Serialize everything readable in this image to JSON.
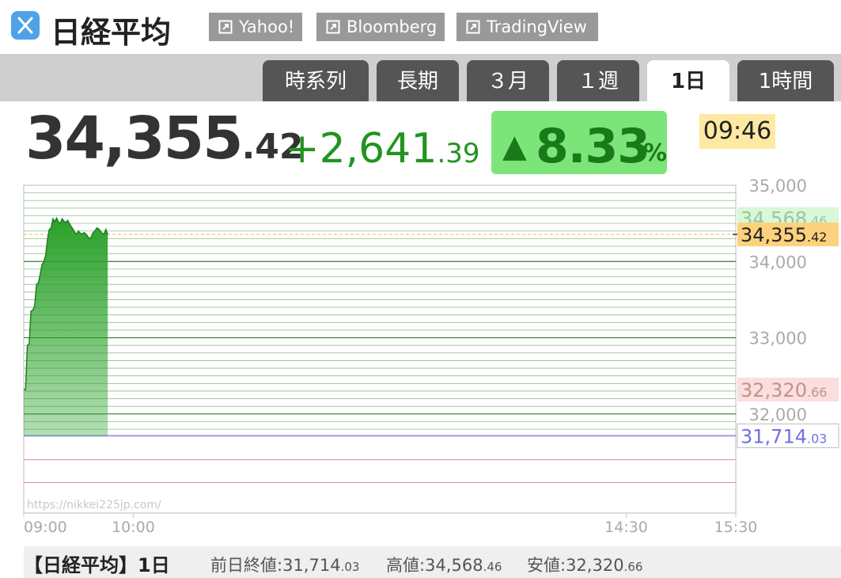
{
  "header": {
    "title": "日経平均",
    "links": [
      {
        "label": "Yahoo!"
      },
      {
        "label": "Bloomberg"
      },
      {
        "label": "TradingView"
      }
    ]
  },
  "tabs": [
    {
      "label": "時系列",
      "active": false
    },
    {
      "label": "長期",
      "active": false
    },
    {
      "label": "３月",
      "active": false
    },
    {
      "label": "１週",
      "active": false
    },
    {
      "label": "1日",
      "active": true
    },
    {
      "label": "1時間",
      "active": false
    }
  ],
  "quote": {
    "price_int": "34,355",
    "price_dec": ".42",
    "change_int": "+2,641",
    "change_dec": ".39",
    "pct_arrow": "▲",
    "pct_value": "8.33",
    "pct_unit": "%",
    "time": "09:46"
  },
  "colors": {
    "up": "#22941f",
    "pct_bg": "#7ce57a",
    "line_fill": "#2aa12a",
    "prev_close": "#7070e8",
    "high_bg": "#d8f8d8",
    "low_bg": "#fbdede",
    "current_bg": "#fcd27e",
    "time_bg": "#fde9a3"
  },
  "chart_data": {
    "type": "area",
    "xlabel": "",
    "ylabel": "",
    "ylim": [
      30700,
      35000
    ],
    "xlim": [
      "09:00",
      "15:30"
    ],
    "grid": true,
    "y_ticks": [
      "35,000",
      "34,000",
      "33,000",
      "32,000"
    ],
    "y_tick_values": [
      35000,
      34000,
      33000,
      32000
    ],
    "x_ticks": [
      "09:00",
      "10:00",
      "14:30",
      "15:30"
    ],
    "series": [
      {
        "x": [
          "09:00",
          "09:01",
          "09:02",
          "09:03",
          "09:04",
          "09:05",
          "09:06",
          "09:07",
          "09:08",
          "09:09",
          "09:10",
          "09:11",
          "09:12",
          "09:13",
          "09:14",
          "09:15",
          "09:16",
          "09:17",
          "09:18",
          "09:19",
          "09:20",
          "09:21",
          "09:22",
          "09:23",
          "09:24",
          "09:25",
          "09:26",
          "09:27",
          "09:28",
          "09:29",
          "09:30",
          "09:31",
          "09:32",
          "09:33",
          "09:34",
          "09:35",
          "09:36",
          "09:37",
          "09:38",
          "09:39",
          "09:40",
          "09:41",
          "09:42",
          "09:43",
          "09:44",
          "09:45",
          "09:46"
        ],
        "y": [
          32320.66,
          32320.66,
          32900,
          32920,
          33350,
          33360,
          33420,
          33700,
          33720,
          33830,
          33960,
          34000,
          34080,
          34290,
          34420,
          34440,
          34560,
          34520,
          34568.46,
          34520,
          34500,
          34560,
          34530,
          34510,
          34540,
          34500,
          34460,
          34420,
          34380,
          34360,
          34400,
          34370,
          34360,
          34380,
          34360,
          34330,
          34300,
          34320,
          34380,
          34400,
          34440,
          34430,
          34400,
          34370,
          34360,
          34420,
          34355.42
        ]
      }
    ],
    "labels": {
      "high": {
        "value": 34568.46,
        "int": "34,568",
        "dec": ".46"
      },
      "current": {
        "value": 34355.42,
        "int": "34,355",
        "dec": ".42"
      },
      "low": {
        "value": 32320.66,
        "int": "32,320",
        "dec": ".66"
      },
      "prev_close": {
        "value": 31714.03,
        "int": "31,714",
        "dec": ".03"
      }
    },
    "watermark": "https://nikkei225jp.com/"
  },
  "footer": {
    "title": "【日経平均】1日",
    "prev_label": "前日終値:",
    "prev_int": "31,714",
    "prev_dec": ".03",
    "high_label": "高値:",
    "high_int": "34,568",
    "high_dec": ".46",
    "low_label": "安値:",
    "low_int": "32,320",
    "low_dec": ".66"
  }
}
